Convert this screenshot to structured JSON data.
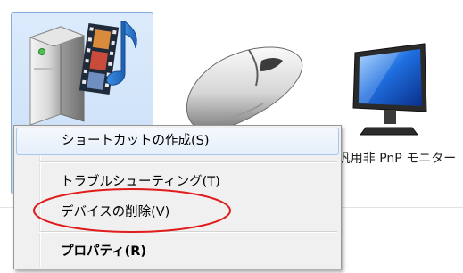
{
  "devices": [
    {
      "id": "media-device",
      "label": "",
      "icon": "media-device-icon",
      "selected": true
    },
    {
      "id": "mouse",
      "label": "",
      "icon": "mouse-icon",
      "selected": false
    },
    {
      "id": "monitor",
      "label": "汎用非 PnP モニター",
      "icon": "monitor-icon",
      "selected": false
    }
  ],
  "context_menu": {
    "items": [
      {
        "label": "ショートカットの作成(S)",
        "hovered": true,
        "bold": false
      },
      {
        "label": "トラブルシューティング(T)",
        "hovered": false,
        "bold": false
      },
      {
        "label": "デバイスの削除(V)",
        "hovered": false,
        "bold": false,
        "circled": true
      },
      {
        "label": "プロパティ(R)",
        "hovered": false,
        "bold": true
      }
    ]
  },
  "colors": {
    "selection_fill": "#cfe2f8",
    "selection_border": "#84acdd",
    "menu_background": "#f0f0f0",
    "annotation": "#e01b1b"
  }
}
